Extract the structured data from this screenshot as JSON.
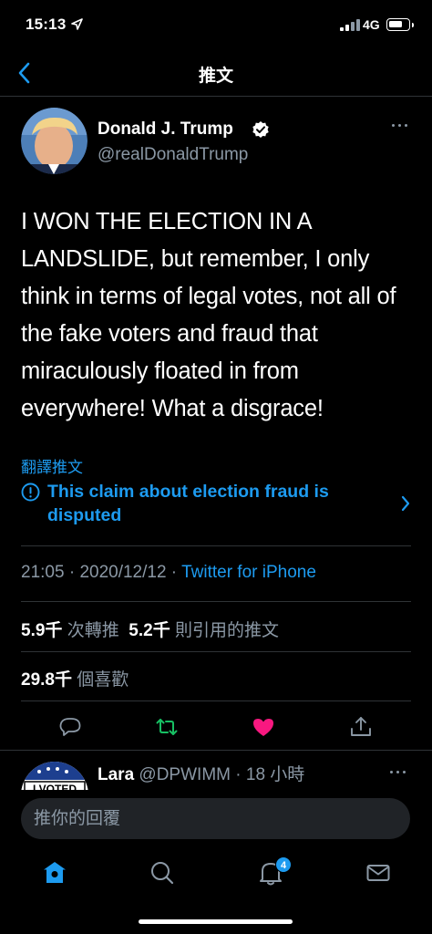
{
  "status_bar": {
    "time": "15:13",
    "network": "4G",
    "icons": [
      "location-arrow-icon",
      "signal-icon",
      "battery-icon"
    ]
  },
  "nav": {
    "title": "推文",
    "back_icon": "chevron-left-icon"
  },
  "tweet": {
    "author_name": "Donald J. Trump",
    "author_handle": "@realDonaldTrump",
    "verified": true,
    "text": "I WON THE ELECTION IN A LANDSLIDE, but remember, I only think in terms of legal votes, not all of the fake voters and fraud that miraculously floated in from everywhere! What a disgrace!",
    "translate_label": "翻譯推文",
    "notice": "This claim about election fraud is disputed",
    "time": "21:05",
    "date": "2020/12/12",
    "source": "Twitter for iPhone",
    "separator": " · "
  },
  "stats": {
    "retweets_count": "5.9千",
    "retweets_label": "次轉推",
    "quotes_count": "5.2千",
    "quotes_label": "則引用的推文",
    "likes_count": "29.8千",
    "likes_label": "個喜歡"
  },
  "actions": [
    {
      "icon": "reply-icon"
    },
    {
      "icon": "retweet-icon",
      "color": "#17bf63"
    },
    {
      "icon": "heart-icon",
      "color": "#f91880"
    },
    {
      "icon": "share-icon"
    }
  ],
  "reply_preview": {
    "name": "Lara",
    "handle": "@DPWIMM",
    "time_sep": " · ",
    "time": "18 小時",
    "avatar_text": "I VOTED"
  },
  "composer": {
    "placeholder": "推你的回覆"
  },
  "tabs": [
    {
      "icon": "home-icon",
      "active": true
    },
    {
      "icon": "search-icon"
    },
    {
      "icon": "bell-icon",
      "badge": "4"
    },
    {
      "icon": "mail-icon"
    }
  ],
  "colors": {
    "accent": "#1d9bf0",
    "secondary_text": "#8b98a5",
    "retweet": "#17bf63",
    "like": "#f91880",
    "background": "#000000"
  }
}
